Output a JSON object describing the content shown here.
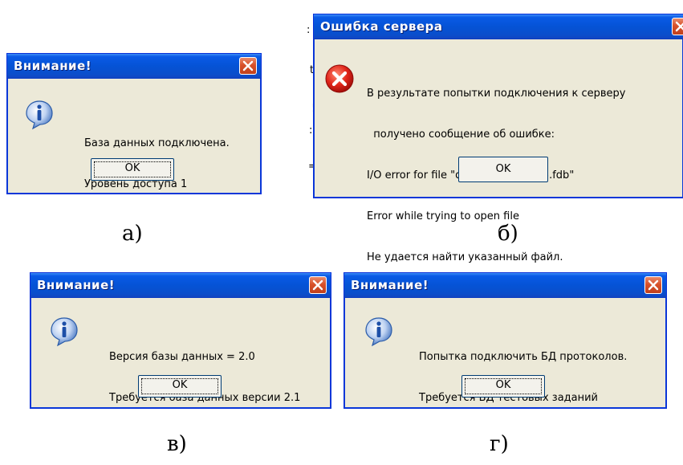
{
  "dialogs": [
    {
      "title": "Внимание!",
      "icon": "info-icon",
      "lines": [
        "База данных подключена.",
        "Уровень доступа 1"
      ],
      "ok": "OK",
      "caption": "а)"
    },
    {
      "title": "Ошибка сервера",
      "icon": "error-icon",
      "lines": [
        "В результате попытки подключения к серверу",
        "  получено сообщение об ошибке:",
        "I/O error for file \"d:\\base\\expert_v3.fdb\"",
        "Error while trying to open file",
        "Не удается найти указанный файл."
      ],
      "ok": "OK",
      "caption": "б)"
    },
    {
      "title": "Внимание!",
      "icon": "info-icon",
      "lines": [
        "Версия базы данных = 2.0",
        "Требуется база данных версии 2.1"
      ],
      "ok": "OK",
      "caption": "в)"
    },
    {
      "title": "Внимание!",
      "icon": "info-icon",
      "lines": [
        "Попытка подключить БД протоколов.",
        "Требуется БД тестовых заданий"
      ],
      "ok": "OK",
      "caption": "г)"
    }
  ],
  "background_fragments": [
    ":",
    "t",
    "!",
    ":",
    "="
  ],
  "colors": {
    "titlebar": "#0553D6",
    "dialog_bg": "#ECE9D8",
    "close": "#D8512A"
  }
}
